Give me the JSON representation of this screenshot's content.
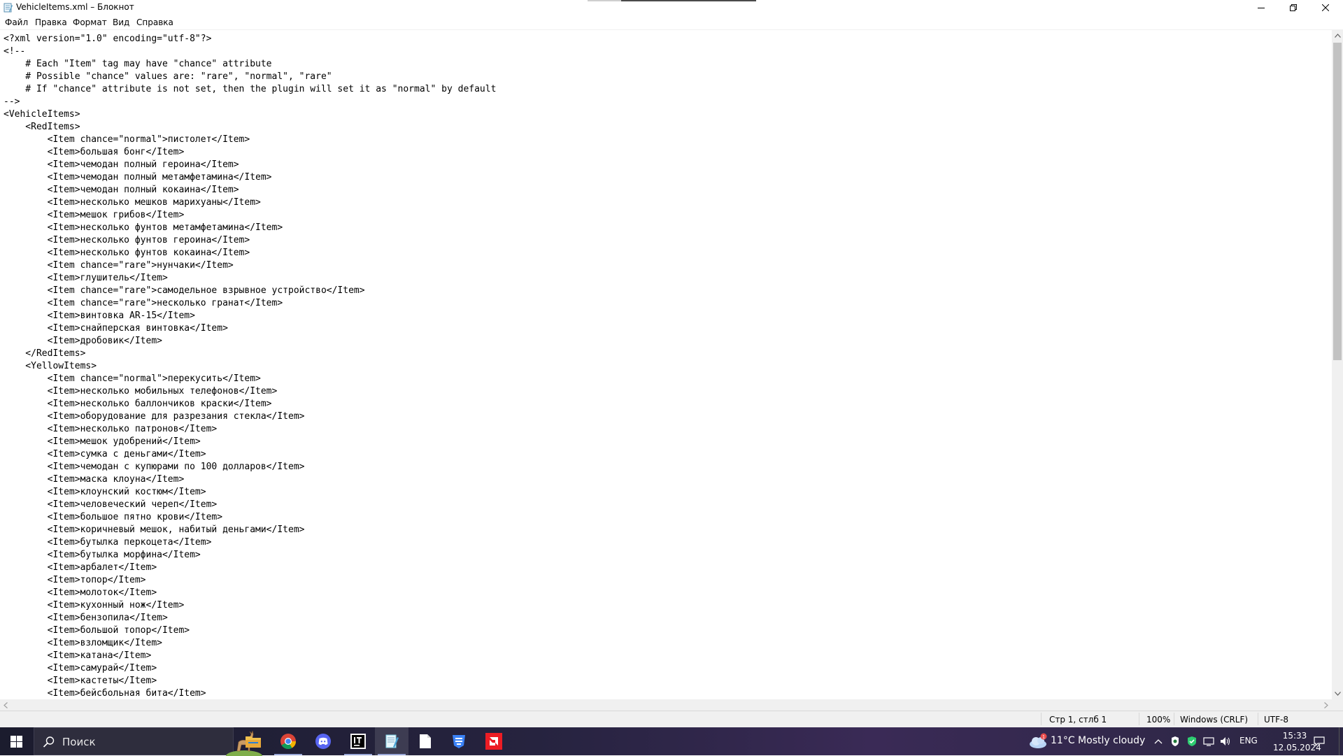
{
  "window": {
    "title": "VehicleItems.xml – Блокнот",
    "controls": [
      "minimize",
      "maximize",
      "close"
    ]
  },
  "menu": [
    {
      "label": "Файл"
    },
    {
      "label": "Правка"
    },
    {
      "label": "Формат"
    },
    {
      "label": "Вид"
    },
    {
      "label": "Справка"
    }
  ],
  "editor": {
    "lines": [
      "<?xml version=\"1.0\" encoding=\"utf-8\"?>",
      "<!--",
      "    # Each \"Item\" tag may have \"chance\" attribute",
      "    # Possible \"chance\" values are: \"rare\", \"normal\", \"rare\"",
      "    # If \"chance\" attribute is not set, then the plugin will set it as \"normal\" by default",
      "-->",
      "<VehicleItems>",
      "    <RedItems>",
      "        <Item chance=\"normal\">пистолет</Item>",
      "        <Item>большая бонг</Item>",
      "        <Item>чемодан полный героина</Item>",
      "        <Item>чемодан полный метамфетамина</Item>",
      "        <Item>чемодан полный кокаина</Item>",
      "        <Item>несколько мешков марихуаны</Item>",
      "        <Item>мешок грибов</Item>",
      "        <Item>несколько фунтов метамфетамина</Item>",
      "        <Item>несколько фунтов героина</Item>",
      "        <Item>несколько фунтов кокаина</Item>",
      "        <Item chance=\"rare\">нунчаки</Item>",
      "        <Item>глушитель</Item>",
      "        <Item chance=\"rare\">самодельное взрывное устройство</Item>",
      "        <Item chance=\"rare\">несколько гранат</Item>",
      "        <Item>винтовка AR-15</Item>",
      "        <Item>снайперская винтовка</Item>",
      "        <Item>дробовик</Item>",
      "    </RedItems>",
      "    <YellowItems>",
      "        <Item chance=\"normal\">перекусить</Item>",
      "        <Item>несколько мобильных телефонов</Item>",
      "        <Item>несколько баллончиков краски</Item>",
      "        <Item>оборудование для разрезания стекла</Item>",
      "        <Item>несколько патронов</Item>",
      "        <Item>мешок удобрений</Item>",
      "        <Item>сумка с деньгами</Item>",
      "        <Item>чемодан с купюрами по 100 долларов</Item>",
      "        <Item>маска клоуна</Item>",
      "        <Item>клоунский костюм</Item>",
      "        <Item>человеческий череп</Item>",
      "        <Item>большое пятно крови</Item>",
      "        <Item>коричневый мешок, набитый деньгами</Item>",
      "        <Item>бутылка перкоцета</Item>",
      "        <Item>бутылка морфина</Item>",
      "        <Item>арбалет</Item>",
      "        <Item>топор</Item>",
      "        <Item>молоток</Item>",
      "        <Item>кухонный нож</Item>",
      "        <Item>бензопила</Item>",
      "        <Item>большой топор</Item>",
      "        <Item>взломщик</Item>",
      "        <Item>катана</Item>",
      "        <Item>самурай</Item>",
      "        <Item>кастеты</Item>",
      "        <Item>бейсбольная бита</Item>"
    ]
  },
  "scroll": {
    "vertical_position": 0.0,
    "vertical_visible_fraction": 0.48
  },
  "status": {
    "position": "Стр 1, стлб 1",
    "zoom": "100%",
    "line_endings": "Windows (CRLF)",
    "encoding": "UTF-8"
  },
  "taskbar": {
    "search_placeholder": "Поиск",
    "apps": [
      {
        "name": "file-explorer-icon",
        "color": "#f2c14e"
      },
      {
        "name": "chrome-icon",
        "color": "#4285f4"
      },
      {
        "name": "discord-icon",
        "color": "#5865f2"
      },
      {
        "name": "intellij-icon",
        "color": "#000000"
      },
      {
        "name": "notepad-icon",
        "color": "#7fd0e6"
      },
      {
        "name": "file-icon",
        "color": "#ffffff"
      },
      {
        "name": "brave-like-blue-icon",
        "color": "#3b82f6"
      },
      {
        "name": "amd-icon",
        "color": "#ed1c24"
      }
    ],
    "weather": {
      "badge": "1",
      "temperature": "11°C",
      "condition": "Mostly cloudy"
    },
    "language": "ENG",
    "time": "15:33",
    "date": "12.05.2024"
  }
}
